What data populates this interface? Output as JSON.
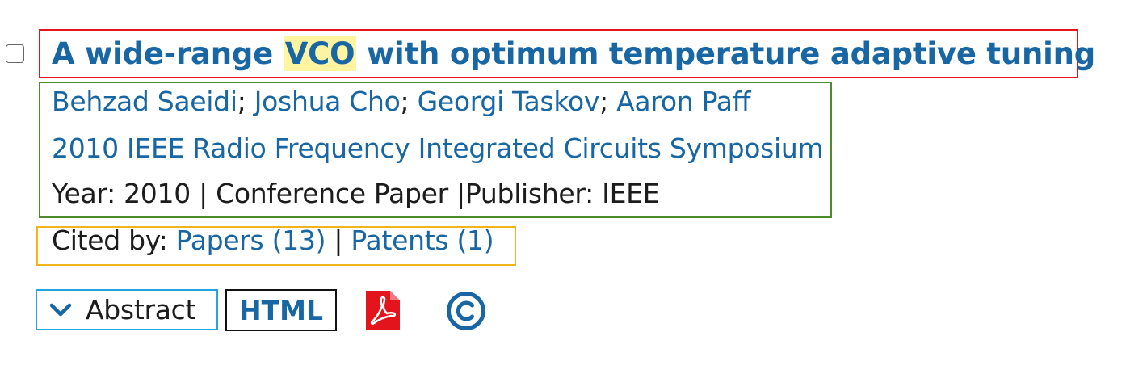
{
  "result": {
    "title_prefix": "A wide-range ",
    "title_highlight": "VCO",
    "title_suffix": " with optimum temperature adaptive tuning",
    "authors": [
      "Behzad Saeidi",
      "Joshua Cho",
      "Georgi Taskov",
      "Aaron Paff"
    ],
    "author_separator": ";",
    "venue": "2010 IEEE Radio Frequency Integrated Circuits Symposium",
    "meta": {
      "year_label": "Year:",
      "year": "2010",
      "type": "Conference Paper",
      "publisher_label": "Publisher:",
      "publisher": "IEEE",
      "separator": "|"
    },
    "cited_by": {
      "label": "Cited by:",
      "papers": "Papers (13)",
      "patents": "Patents (1)",
      "separator": "|"
    },
    "actions": {
      "abstract_label": "Abstract",
      "html_label": "HTML"
    }
  },
  "colors": {
    "link": "#1866a3",
    "highlight": "#fff4a0",
    "title_box": "#e3141b",
    "meta_box": "#4d8b2d",
    "cited_box": "#f0b51b",
    "abstract_box": "#23a6df",
    "html_box": "#111111",
    "pdf_icon": "#e3141b"
  },
  "icons": {
    "checkbox": "checkbox-icon",
    "abstract_toggle": "chevron-down-icon",
    "pdf": "pdf-icon",
    "copyright": "copyright-icon"
  }
}
